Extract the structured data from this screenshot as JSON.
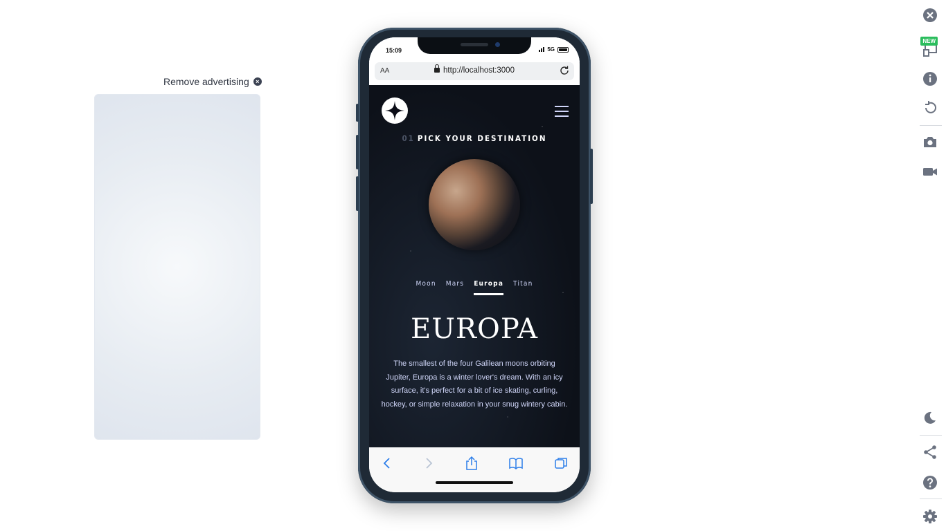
{
  "ad": {
    "remove_label": "Remove advertising"
  },
  "device": {
    "time": "15:09",
    "network": "5G",
    "url": "http://localhost:3000",
    "aa_label": "AA"
  },
  "site": {
    "section_number": "01",
    "section_title": "PICK YOUR DESTINATION",
    "tabs": [
      {
        "label": "Moon",
        "active": false
      },
      {
        "label": "Mars",
        "active": false
      },
      {
        "label": "Europa",
        "active": true
      },
      {
        "label": "Titan",
        "active": false
      }
    ],
    "destination_name": "EUROPA",
    "description": "The smallest of the four Galilean moons orbiting Jupiter, Europa is a winter lover's dream. With an icy surface, it's perfect for a bit of ice skating, curling, hockey, or simple relaxation in your snug wintery cabin."
  },
  "toolbar": {
    "new_badge": "NEW",
    "icons": [
      "close-icon",
      "device-icon",
      "info-icon",
      "rotate-icon",
      "camera-icon",
      "video-icon",
      "moon-icon",
      "share-icon",
      "help-icon",
      "settings-icon"
    ]
  },
  "colors": {
    "accent": "#2bbd5d",
    "page_text": "#d0d6f9",
    "toolbar_icon": "#6b7280"
  }
}
